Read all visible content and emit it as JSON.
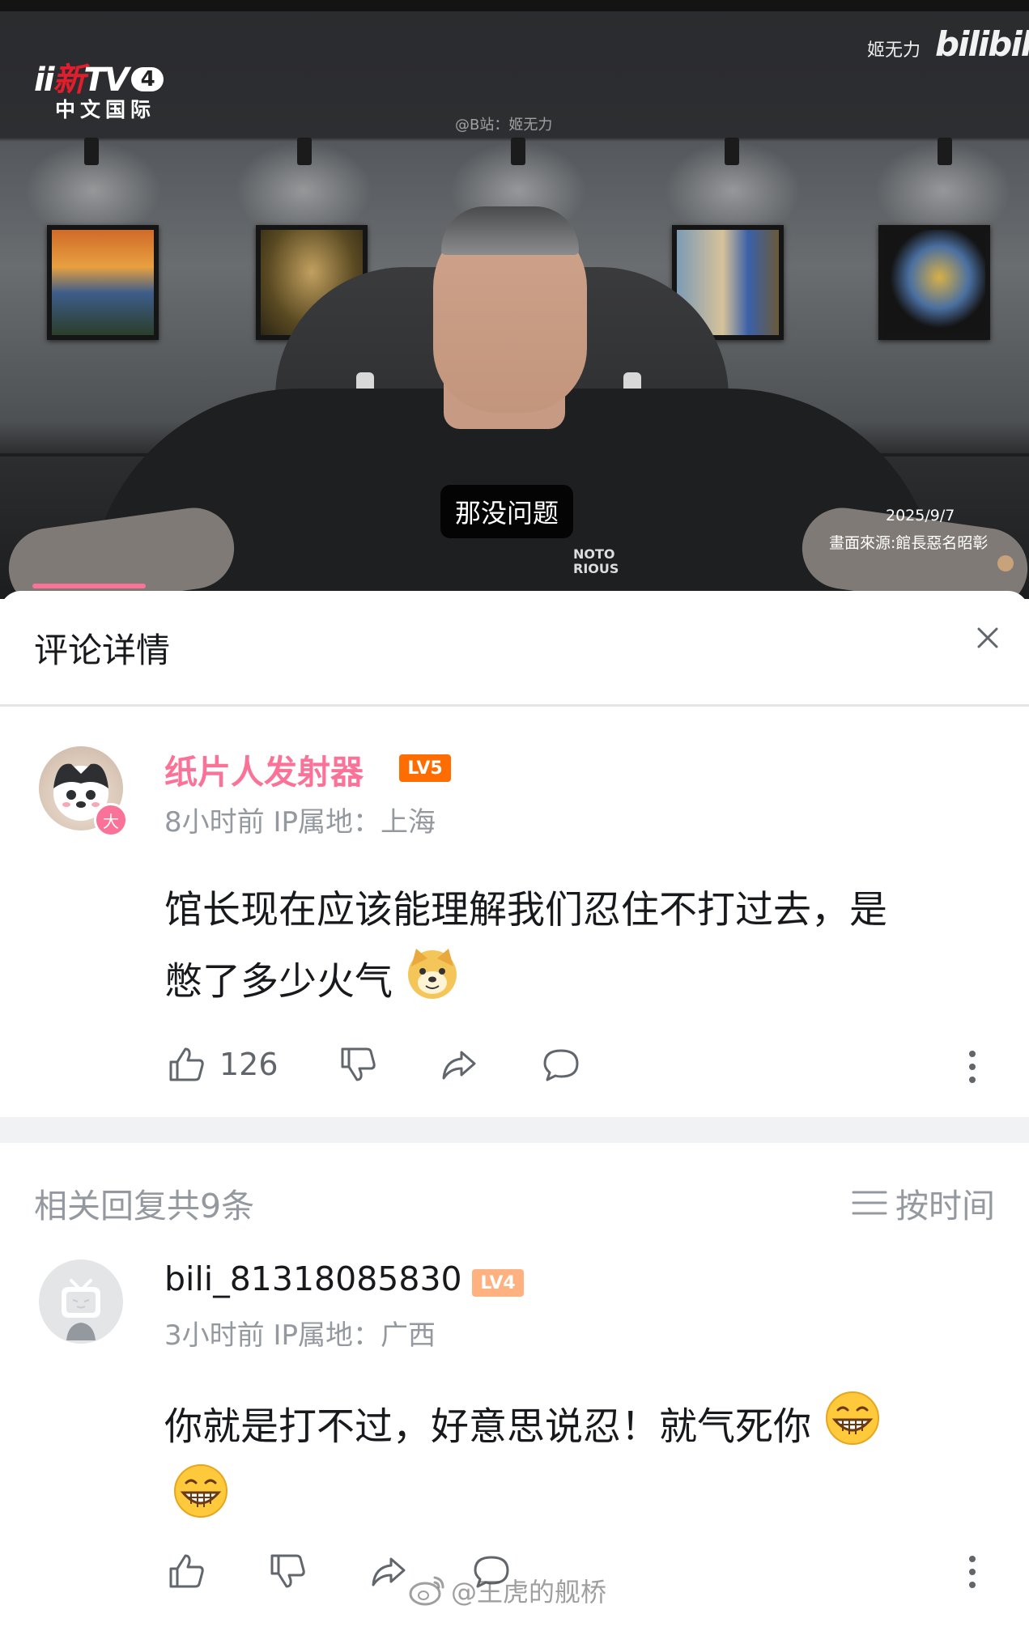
{
  "video": {
    "logo_prefix": "ii",
    "logo_red": "新",
    "logo_tv": "TV",
    "logo_num": "4",
    "logo_sub": "中文国际",
    "watermark_user": "@B站：姬无力",
    "watermark_right": "姬无力",
    "watermark_bili": "bilibili",
    "subtitle": "那没问题",
    "stamp_date": "2025/9/7",
    "stamp_source": "畫面來源:館長惡名昭彰"
  },
  "sheet": {
    "title": "评论详情"
  },
  "main_comment": {
    "username": "纸片人发射器",
    "level": "LV5",
    "avatar_badge": "大",
    "meta": "8小时前 IP属地：上海",
    "line1": "馆长现在应该能理解我们忍住不打过去，是",
    "line2": "憋了多少火气",
    "like_count": "126"
  },
  "replies": {
    "title": "相关回复共9条",
    "sort_label": "按时间"
  },
  "reply": {
    "username": "bili_81318085830",
    "level": "LV4",
    "meta": "3小时前 IP属地：广西",
    "text": "你就是打不过，好意思说忍！就气死你"
  },
  "watermark": {
    "text": "@王虎的舰桥"
  },
  "colors": {
    "accent_pink": "#fb7299",
    "lv5_orange": "#ff6c00",
    "lv4_orange": "#ffb27f",
    "muted": "#9499a0"
  }
}
